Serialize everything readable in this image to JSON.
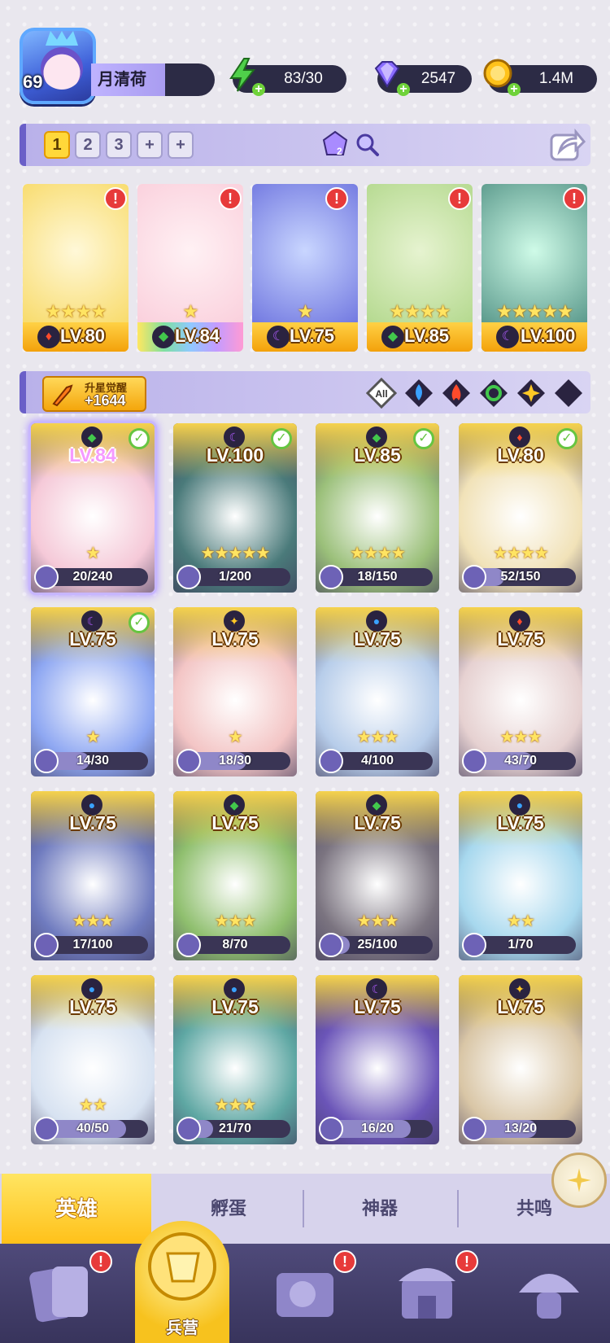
{
  "player": {
    "level": "69",
    "name": "月清荷"
  },
  "resources": [
    {
      "name": "energy",
      "icon": "lightning-icon",
      "value": "83/30",
      "color": "#4fd04a"
    },
    {
      "name": "gems",
      "icon": "gem-icon",
      "value": "2547",
      "color": "#8a6cff"
    },
    {
      "name": "gold",
      "icon": "coin-icon",
      "value": "1.4M",
      "color": "#ffc21a"
    }
  ],
  "team": {
    "slots": [
      "1",
      "2",
      "3"
    ],
    "active_slot": "1",
    "plus_label": "+",
    "badge_count": "2"
  },
  "lineup": [
    {
      "element": "fire",
      "level": "LV.80",
      "stars": "★★★★",
      "color": "#f6d34d"
    },
    {
      "element": "wind",
      "level": "LV.84",
      "stars": "★",
      "color": "#f9c7d6"
    },
    {
      "element": "dark",
      "level": "LV.75",
      "stars": "★",
      "color": "#6b76e8"
    },
    {
      "element": "wind",
      "level": "LV.85",
      "stars": "★★★★",
      "color": "#a7d27d"
    },
    {
      "element": "dark",
      "level": "LV.100",
      "stars": "★★★★★",
      "color": "#52d6a4"
    }
  ],
  "filter": {
    "awaken_label": "升星觉醒",
    "awaken_value": "+1644",
    "all_label": "All",
    "elements": [
      "water",
      "fire",
      "wind",
      "light",
      "dark"
    ]
  },
  "heroes": [
    {
      "level": "LV.84",
      "element": "wind",
      "shards": "20/240",
      "progress": 0.08,
      "stars": "★",
      "checked": true,
      "selected": true,
      "bg": "#f5c9d8"
    },
    {
      "level": "LV.100",
      "element": "dark",
      "shards": "1/200",
      "progress": 0.005,
      "stars": "★★★★★",
      "checked": true,
      "selected": false,
      "bg": "#4a7a7a"
    },
    {
      "level": "LV.85",
      "element": "wind",
      "shards": "18/150",
      "progress": 0.12,
      "stars": "★★★★",
      "checked": true,
      "selected": false,
      "bg": "#9bc07a"
    },
    {
      "level": "LV.80",
      "element": "fire",
      "shards": "52/150",
      "progress": 0.35,
      "stars": "★★★★",
      "checked": true,
      "selected": false,
      "bg": "#f1e2b8"
    },
    {
      "level": "LV.75",
      "element": "dark",
      "shards": "14/30",
      "progress": 0.47,
      "stars": "★",
      "checked": true,
      "selected": false,
      "bg": "#8ea7f2"
    },
    {
      "level": "LV.75",
      "element": "light",
      "shards": "18/30",
      "progress": 0.6,
      "stars": "★",
      "checked": false,
      "selected": false,
      "bg": "#f3c5c5"
    },
    {
      "level": "LV.75",
      "element": "water",
      "shards": "4/100",
      "progress": 0.04,
      "stars": "★★★",
      "checked": false,
      "selected": false,
      "bg": "#b7cdea"
    },
    {
      "level": "LV.75",
      "element": "fire",
      "shards": "43/70",
      "progress": 0.61,
      "stars": "★★★",
      "checked": false,
      "selected": false,
      "bg": "#e6d1d1"
    },
    {
      "level": "LV.75",
      "element": "water",
      "shards": "17/100",
      "progress": 0.17,
      "stars": "★★★",
      "checked": false,
      "selected": false,
      "bg": "#6f7bbf"
    },
    {
      "level": "LV.75",
      "element": "wind",
      "shards": "8/70",
      "progress": 0.11,
      "stars": "★★★",
      "checked": false,
      "selected": false,
      "bg": "#8fbf6e"
    },
    {
      "level": "LV.75",
      "element": "wind",
      "shards": "25/100",
      "progress": 0.25,
      "stars": "★★★",
      "checked": false,
      "selected": false,
      "bg": "#7b7480"
    },
    {
      "level": "LV.75",
      "element": "water",
      "shards": "1/70",
      "progress": 0.015,
      "stars": "★★",
      "checked": false,
      "selected": false,
      "bg": "#a7d8ee"
    },
    {
      "level": "LV.75",
      "element": "water",
      "shards": "40/50",
      "progress": 0.8,
      "stars": "★★",
      "checked": false,
      "selected": false,
      "bg": "#d7e2f1"
    },
    {
      "level": "LV.75",
      "element": "water",
      "shards": "21/70",
      "progress": 0.3,
      "stars": "★★★",
      "checked": false,
      "selected": false,
      "bg": "#5ea7a3"
    },
    {
      "level": "LV.75",
      "element": "dark",
      "shards": "16/20",
      "progress": 0.8,
      "stars": "",
      "checked": false,
      "selected": false,
      "bg": "#6b55b8"
    },
    {
      "level": "LV.75",
      "element": "light",
      "shards": "13/20",
      "progress": 0.65,
      "stars": "",
      "checked": false,
      "selected": false,
      "bg": "#d9c6a6"
    }
  ],
  "sub_tabs": [
    "英雄",
    "孵蛋",
    "神器",
    "共鸣"
  ],
  "nav": {
    "center_label": "兵营",
    "items": [
      "cards-icon",
      "barracks-icon",
      "book-icon",
      "shop-icon",
      "mushroom-icon"
    ]
  },
  "colors": {
    "fire": "#ff4b2b",
    "wind": "#42c84c",
    "water": "#3aa2ff",
    "light": "#ffc825",
    "dark": "#b05cff",
    "accent": "#ffc11a"
  }
}
